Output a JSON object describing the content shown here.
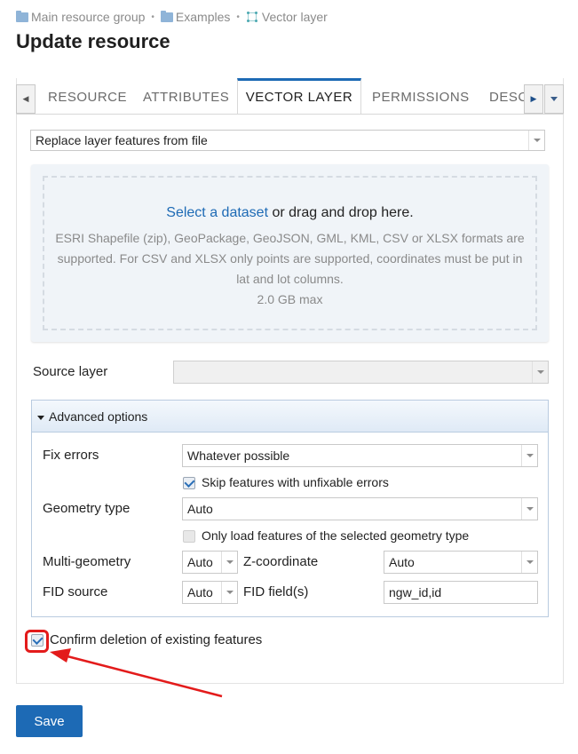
{
  "breadcrumb": {
    "items": [
      {
        "label": "Main resource group",
        "icon": "folder-icon"
      },
      {
        "label": "Examples",
        "icon": "folder-icon"
      },
      {
        "label": "Vector layer",
        "icon": "vector-layer-icon"
      }
    ],
    "separator": "•"
  },
  "page": {
    "title": "Update resource"
  },
  "tabs": [
    {
      "label": "RESOURCE",
      "active": false
    },
    {
      "label": "ATTRIBUTES",
      "active": false
    },
    {
      "label": "VECTOR LAYER",
      "active": true
    },
    {
      "label": "PERMISSIONS",
      "active": false
    },
    {
      "label": "DESC",
      "active": false
    }
  ],
  "mode_select": {
    "value": "Replace layer features from file"
  },
  "dropzone": {
    "link_text": "Select a dataset",
    "main_text": " or drag and drop here.",
    "formats_text": "ESRI Shapefile (zip), GeoPackage, GeoJSON, GML, KML, CSV or XLSX formats are supported. For CSV and XLSX only points are supported, coordinates must be put in lat and lot columns.",
    "max_text": "2.0 GB max"
  },
  "source_layer": {
    "label": "Source layer",
    "value": ""
  },
  "advanced": {
    "title": "Advanced options",
    "fix_errors": {
      "label": "Fix errors",
      "value": "Whatever possible"
    },
    "skip_unfixable": {
      "label": "Skip features with unfixable errors",
      "checked": true
    },
    "geometry_type": {
      "label": "Geometry type",
      "value": "Auto"
    },
    "only_selected_geom": {
      "label": "Only load features of the selected geometry type",
      "checked": false
    },
    "multi_geometry": {
      "label": "Multi-geometry",
      "value": "Auto"
    },
    "z_coordinate": {
      "label": "Z-coordinate",
      "value": "Auto"
    },
    "fid_source": {
      "label": "FID source",
      "value": "Auto"
    },
    "fid_fields": {
      "label": "FID field(s)",
      "value": "ngw_id,id"
    }
  },
  "confirm_deletion": {
    "label": "Confirm deletion of existing features",
    "checked": true
  },
  "save_button": {
    "label": "Save"
  },
  "colors": {
    "accent": "#1d6ab5",
    "annotation": "#e31b1b"
  }
}
